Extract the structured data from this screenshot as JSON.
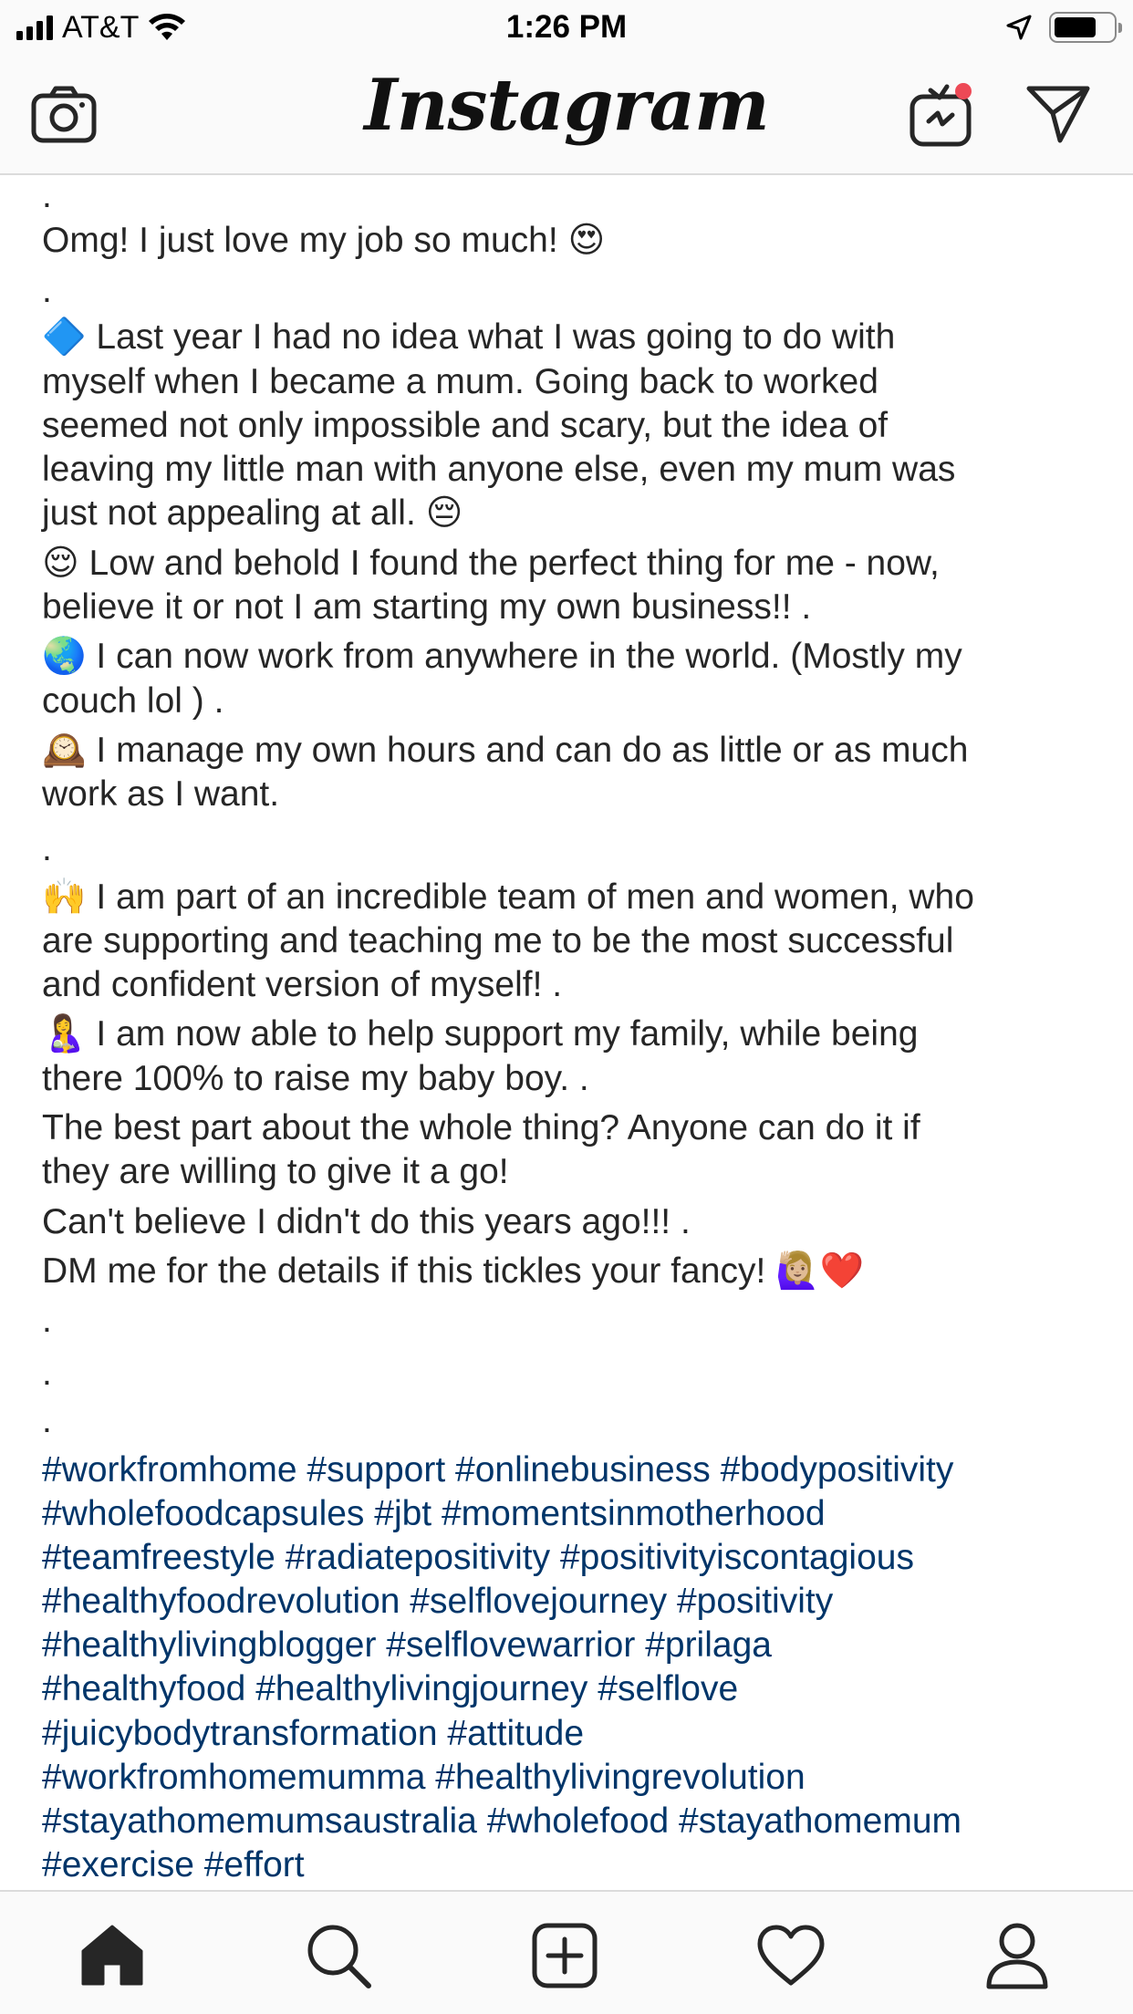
{
  "status_bar": {
    "carrier": "AT&T",
    "time": "1:26 PM",
    "battery_level": 0.72
  },
  "header": {
    "logo_text": "Instagram",
    "icons": [
      "camera-icon",
      "igtv-icon",
      "direct-message-icon"
    ]
  },
  "caption": {
    "lines": [
      ".",
      "Omg! I just love my job so much! 😍",
      "."
    ],
    "paragraphs": [
      {
        "emoji": "🔷",
        "lines": [
          " Last year I had no idea what I was going to do with",
          "myself when I became a mum. Going back to worked",
          "seemed not only impossible and scary, but the idea of",
          "leaving my little man with anyone else, even my mum was",
          "just not appealing at all. 😔"
        ]
      },
      {
        "emoji": "😌",
        "lines": [
          " Low and behold I found the perfect thing for me - now,",
          "believe it or not I am starting my own business!! ."
        ]
      },
      {
        "emoji": "🌏",
        "lines": [
          " I can now work from anywhere in the world. (Mostly my",
          "couch lol ) ."
        ]
      },
      {
        "emoji": "🕰️",
        "lines": [
          " I manage my own hours and can do as little or as much",
          "work as I want."
        ]
      }
    ],
    "dot_after_hours": ".",
    "paragraphs_2": [
      {
        "emoji": "🙌",
        "lines": [
          " I am part of an incredible team of men and women, who",
          "are supporting and teaching me to be the most successful",
          "and confident version of myself! ."
        ]
      },
      {
        "emoji": "🤱",
        "lines": [
          " I am now able to help support my family, while being",
          "there 100% to raise my baby boy. ."
        ]
      }
    ],
    "closing_lines": [
      "The best part about the whole thing? Anyone can do it if",
      "they are willing to give it a go!",
      "Can't believe I didn't do this years ago!!! .",
      "DM me for the details if this tickles your fancy! 🙋🏼‍♀️❤️"
    ],
    "trailing_dots": [
      ".",
      ".",
      "."
    ]
  },
  "hashtags": [
    "#workfromhome #support #onlinebusiness #bodypositivity",
    "#wholefoodcapsules #jbt #momentsinmotherhood",
    "#teamfreestyle #radiatepositivity #positivityiscontagious",
    "#healthyfoodrevolution #selflovejourney #positivity",
    "#healthylivingblogger #selflovewarrior #prilaga",
    "#healthyfood #healthylivingjourney #selflove",
    "#juicybodytransformation #attitude",
    "#workfromhomemumma #healthylivingrevolution",
    "#stayathomemumsaustralia #wholefood #stayathomemum",
    "#exercise #effort"
  ],
  "tab_bar": {
    "tabs": [
      "home-icon",
      "search-icon",
      "new-post-icon",
      "activity-heart-icon",
      "profile-icon"
    ],
    "active": "home-icon"
  },
  "colors": {
    "text": "#262626",
    "hashtag": "#003569",
    "bar_bg": "#fafafa",
    "divider": "#dbdbdb",
    "notification": "#ed4956"
  }
}
